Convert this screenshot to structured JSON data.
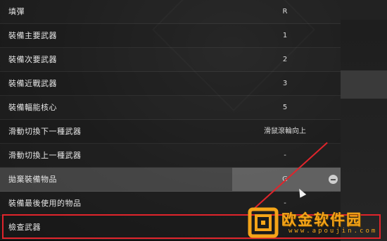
{
  "keybindings": [
    {
      "action": "填彈",
      "key": "R"
    },
    {
      "action": "裝備主要武器",
      "key": "1"
    },
    {
      "action": "裝備次要武器",
      "key": "2"
    },
    {
      "action": "裝備近戰武器",
      "key": "3"
    },
    {
      "action": "裝備輻能核心",
      "key": "5"
    },
    {
      "action": "滑動切換下一種武器",
      "key": "滑鼠滾輪向上"
    },
    {
      "action": "滑動切換上一種武器",
      "key": "-"
    },
    {
      "action": "拋棄裝備物品",
      "key": "G"
    },
    {
      "action": "裝備最後使用的物品",
      "key": "-"
    },
    {
      "action": "檢查武器",
      "key": ""
    }
  ],
  "watermark": {
    "title": "欧金软件园",
    "url": "www.apoujin.com"
  },
  "colors": {
    "annotation": "#e0242b",
    "watermark": "#f4a418"
  }
}
